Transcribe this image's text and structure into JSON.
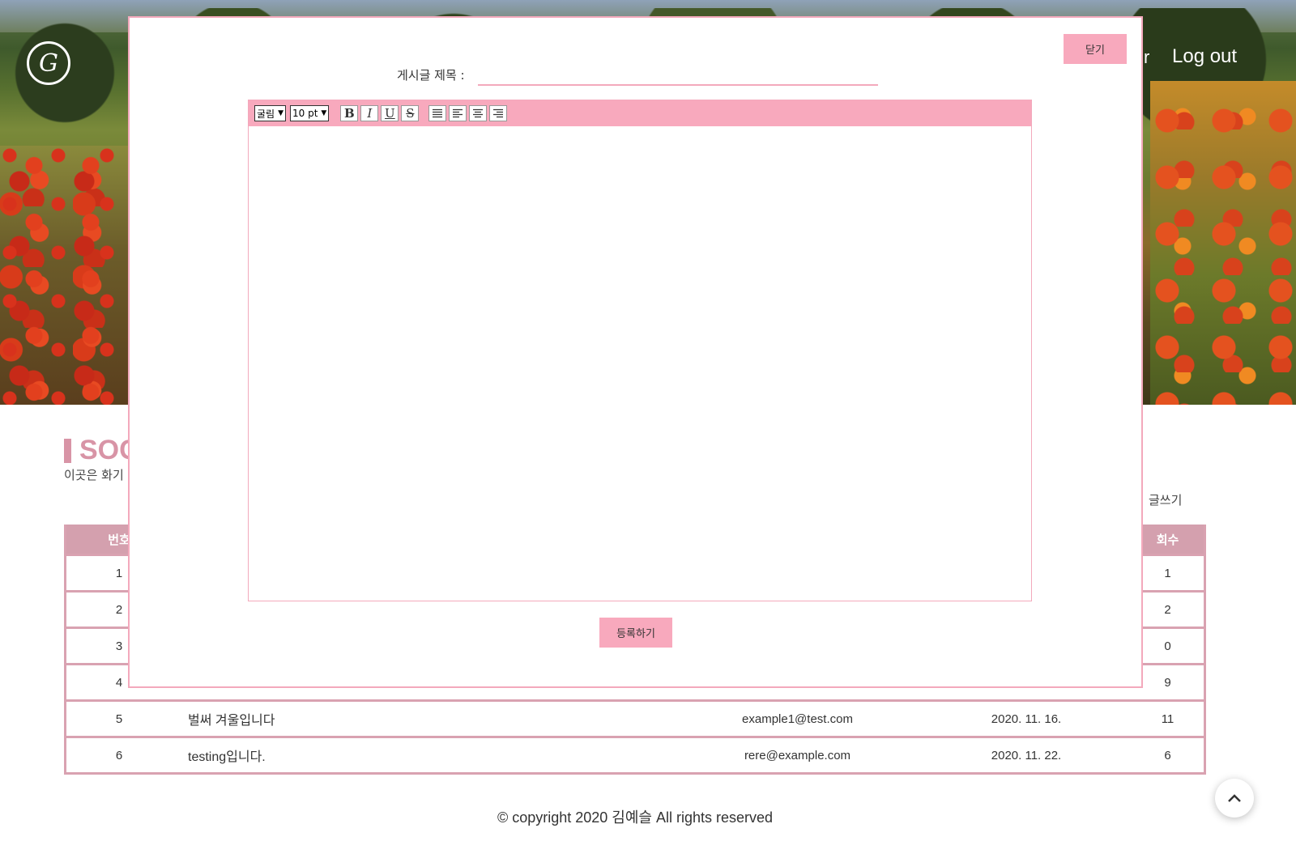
{
  "header": {
    "logo_letter": "G",
    "nav_partial": "r",
    "logout_label": "Log out"
  },
  "board": {
    "heading_partial": "SOC",
    "desc_partial": "이곳은 화기",
    "write_label": "글쓰기",
    "columns": {
      "num_partial": "번호",
      "views_partial": "회수"
    },
    "rows": [
      {
        "num": "1",
        "title": "",
        "author": "",
        "date": "",
        "views": "1"
      },
      {
        "num": "2",
        "title": "",
        "author": "",
        "date": "",
        "views": "2"
      },
      {
        "num": "3",
        "title": "",
        "author": "",
        "date": "",
        "views": "0"
      },
      {
        "num": "4",
        "title": "",
        "author": "",
        "date": "",
        "views": "9"
      },
      {
        "num": "5",
        "title": "벌써 겨울입니다",
        "author": "example1@test.com",
        "date": "2020. 11. 16.",
        "views": "11"
      },
      {
        "num": "6",
        "title": "testing입니다.",
        "author": "rere@example.com",
        "date": "2020. 11. 22.",
        "views": "6"
      }
    ]
  },
  "modal": {
    "close_label": "닫기",
    "title_label": "게시글 제목 :",
    "title_value": "",
    "font_select": "굴림",
    "size_select": "10 pt",
    "bold_glyph": "B",
    "italic_glyph": "I",
    "underline_glyph": "U",
    "strike_glyph": "S",
    "submit_label": "등록하기"
  },
  "footer": {
    "copyright": "© copyright 2020 김예슬 All rights reserved",
    "to_top_glyph": "⌃"
  },
  "colors": {
    "accent_pink": "#f8a9bd",
    "table_pink": "#d4a0ae",
    "heading_pink": "#d894a6"
  }
}
